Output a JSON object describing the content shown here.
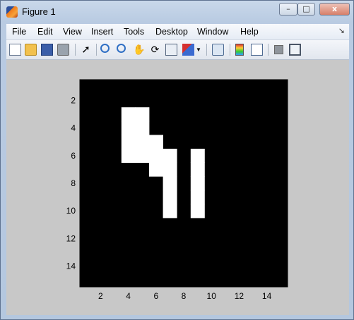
{
  "window": {
    "title": "Figure 1"
  },
  "title_buttons": {
    "minimize": "–",
    "maximize": "□",
    "close": "x"
  },
  "menu": [
    "File",
    "Edit",
    "View",
    "Insert",
    "Tools",
    "Desktop",
    "Window",
    "Help"
  ],
  "toolbar_icons": [
    "new-figure-icon",
    "open-file-icon",
    "save-icon",
    "print-icon",
    "select-arrow-icon",
    "zoom-in-icon",
    "zoom-out-icon",
    "pan-hand-icon",
    "rotate-3d-icon",
    "data-cursor-icon",
    "brush-icon",
    "brush-dropdown-icon",
    "link-plot-icon",
    "colorbar-icon",
    "legend-icon",
    "hide-plot-tools-icon",
    "show-plot-tools-icon"
  ],
  "colors": {
    "background": "#000000",
    "foreground": "#ffffff",
    "figure": "#c8c8c8"
  },
  "chart_data": {
    "type": "heatmap",
    "title": "",
    "xlabel": "",
    "ylabel": "",
    "xlim": [
      0.5,
      15.5
    ],
    "ylim": [
      0.5,
      15.5
    ],
    "y_reversed": true,
    "xticks": [
      2,
      4,
      6,
      8,
      10,
      12,
      14
    ],
    "yticks": [
      2,
      4,
      6,
      8,
      10,
      12,
      14
    ],
    "grid": false,
    "colormap": "gray",
    "rows": 15,
    "cols": 15,
    "white_cells": [
      [
        3,
        4
      ],
      [
        3,
        5
      ],
      [
        4,
        4
      ],
      [
        4,
        5
      ],
      [
        5,
        4
      ],
      [
        5,
        5
      ],
      [
        5,
        6
      ],
      [
        6,
        4
      ],
      [
        6,
        5
      ],
      [
        6,
        6
      ],
      [
        6,
        7
      ],
      [
        6,
        9
      ],
      [
        7,
        6
      ],
      [
        7,
        7
      ],
      [
        7,
        9
      ],
      [
        8,
        7
      ],
      [
        8,
        9
      ],
      [
        9,
        7
      ],
      [
        9,
        9
      ],
      [
        10,
        7
      ],
      [
        10,
        9
      ]
    ]
  }
}
